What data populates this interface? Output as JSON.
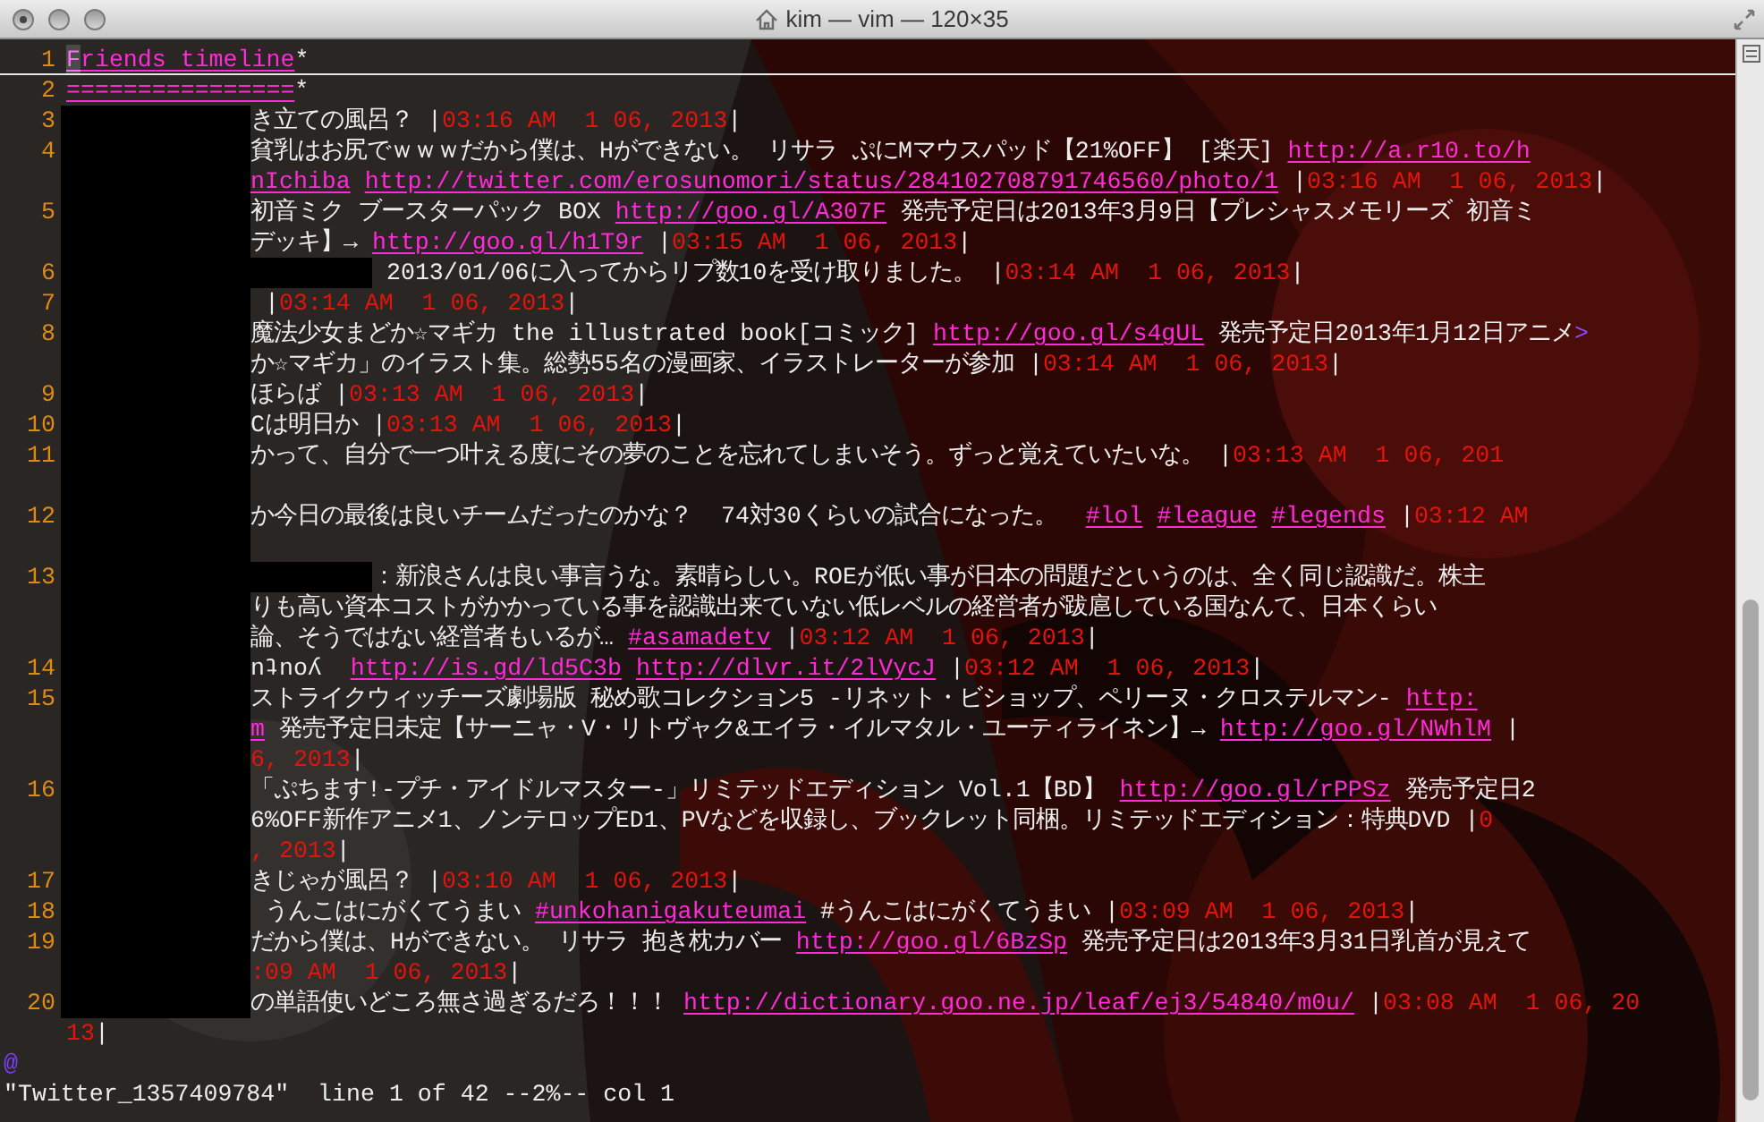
{
  "window": {
    "title": "kim — vim — 120×35"
  },
  "rows": [
    {
      "number": "1",
      "kind": "plain",
      "cursorline": true,
      "segments": [
        {
          "kind": "cursor",
          "text": "F"
        },
        {
          "kind": "title",
          "text": "riends timeline"
        },
        {
          "kind": "text",
          "text": "*"
        }
      ]
    },
    {
      "number": "2",
      "kind": "plain",
      "cursorline": false,
      "segments": [
        {
          "kind": "title",
          "text": "================"
        },
        {
          "kind": "text",
          "text": "*"
        }
      ]
    },
    {
      "number": "3",
      "kind": "redacted",
      "cursorline": false,
      "segments": [
        {
          "kind": "text",
          "text": "き立ての風呂？ |"
        },
        {
          "kind": "time",
          "text": "03:16 AM  1 06, 2013"
        },
        {
          "kind": "text",
          "text": "|"
        }
      ]
    },
    {
      "number": "4",
      "kind": "redacted",
      "cursorline": false,
      "segments": [
        {
          "kind": "text",
          "text": "貧乳はお尻でｗｗｗだから僕は、Hができない。 リサラ ぷにMマウスパッド【21%OFF】 [楽天] "
        },
        {
          "kind": "link",
          "text": "http://a.r10.to/h"
        }
      ]
    },
    {
      "kind": "redacted",
      "cursorline": false,
      "segments": [
        {
          "kind": "link",
          "text": "nIchiba"
        },
        {
          "kind": "link",
          "text": "http://twitter.com/erosunomori/status/284102708791746560/photo/1"
        },
        {
          "kind": "text",
          "text": " |"
        },
        {
          "kind": "time",
          "text": "03:16 AM  1 06, 2013"
        },
        {
          "kind": "text",
          "text": "|"
        }
      ]
    },
    {
      "number": "5",
      "kind": "redacted",
      "cursorline": false,
      "segments": [
        {
          "kind": "text",
          "text": "初音ミク ブースターパック BOX "
        },
        {
          "kind": "link",
          "text": "http://goo.gl/A307F"
        },
        {
          "kind": "text",
          "text": " 発売予定日は2013年3月9日【プレシャスメモリーズ 初音ミ"
        }
      ]
    },
    {
      "kind": "redacted",
      "cursorline": false,
      "segments": [
        {
          "kind": "text",
          "text": "デッキ】→ "
        },
        {
          "kind": "link",
          "text": "http://goo.gl/h1T9r"
        },
        {
          "kind": "text",
          "text": " |"
        },
        {
          "kind": "time",
          "text": "03:15 AM  1 06, 2013"
        },
        {
          "kind": "text",
          "text": "|"
        }
      ]
    },
    {
      "number": "6",
      "kind": "redacted_wide",
      "cursorline": false,
      "segments": [
        {
          "kind": "text",
          "text": " 2013/01/06に入ってからリプ数10を受け取りました。 |"
        },
        {
          "kind": "time",
          "text": "03:14 AM  1 06, 2013"
        },
        {
          "kind": "text",
          "text": "|"
        }
      ]
    },
    {
      "number": "7",
      "kind": "redacted",
      "cursorline": false,
      "segments": [
        {
          "kind": "text",
          "text": " |"
        },
        {
          "kind": "time",
          "text": "03:14 AM  1 06, 2013"
        },
        {
          "kind": "text",
          "text": "|"
        }
      ]
    },
    {
      "number": "8",
      "kind": "redacted",
      "cursorline": false,
      "segments": [
        {
          "kind": "text",
          "text": "魔法少女まどか☆マギカ the illustrated book[コミック] "
        },
        {
          "kind": "link",
          "text": "http://goo.gl/s4gUL"
        },
        {
          "kind": "text",
          "text": " 発売予定日2013年1月12日アニメ"
        },
        {
          "kind": "more",
          "text": ">"
        }
      ]
    },
    {
      "kind": "redacted",
      "cursorline": false,
      "segments": [
        {
          "kind": "text",
          "text": "か☆マギカ」のイラスト集。総勢55名の漫画家、イラストレーターが参加 |"
        },
        {
          "kind": "time",
          "text": "03:14 AM  1 06, 2013"
        },
        {
          "kind": "text",
          "text": "|"
        }
      ]
    },
    {
      "number": "9",
      "kind": "redacted",
      "cursorline": false,
      "segments": [
        {
          "kind": "text",
          "text": "ほらば |"
        },
        {
          "kind": "time",
          "text": "03:13 AM  1 06, 2013"
        },
        {
          "kind": "text",
          "text": "|"
        }
      ]
    },
    {
      "number": "10",
      "kind": "redacted",
      "cursorline": false,
      "segments": [
        {
          "kind": "text",
          "text": "Cは明日か |"
        },
        {
          "kind": "time",
          "text": "03:13 AM  1 06, 2013"
        },
        {
          "kind": "text",
          "text": "|"
        }
      ]
    },
    {
      "number": "11",
      "kind": "redacted",
      "cursorline": false,
      "segments": [
        {
          "kind": "text",
          "text": "かって、自分で一つ叶える度にその夢のことを忘れてしまいそう。ずっと覚えていたいな。 |"
        },
        {
          "kind": "time",
          "text": "03:13 AM  1 06, 201"
        }
      ]
    },
    {
      "kind": "redacted",
      "cursorline": false,
      "segments": []
    },
    {
      "number": "12",
      "kind": "redacted",
      "cursorline": false,
      "segments": [
        {
          "kind": "text",
          "text": "か今日の最後は良いチームだったのかな？  74対30くらいの試合になった。  "
        },
        {
          "kind": "link",
          "text": "#lol"
        },
        {
          "kind": "link",
          "text": "#league"
        },
        {
          "kind": "link",
          "text": "#legends"
        },
        {
          "kind": "text",
          "text": " |"
        },
        {
          "kind": "time",
          "text": "03:12 AM"
        }
      ]
    },
    {
      "kind": "redacted",
      "cursorline": false,
      "segments": []
    },
    {
      "number": "13",
      "kind": "redacted_wide",
      "cursorline": false,
      "segments": [
        {
          "kind": "text",
          "text": "：新浪さんは良い事言うな。素晴らしい。ROEが低い事が日本の問題だというのは、全く同じ認識だ。株主"
        }
      ]
    },
    {
      "kind": "redacted",
      "cursorline": false,
      "segments": [
        {
          "kind": "text",
          "text": "りも高い資本コストがかかっている事を認識出来ていない低レベルの経営者が跋扈している国なんて、日本くらい"
        }
      ]
    },
    {
      "kind": "redacted",
      "cursorline": false,
      "segments": [
        {
          "kind": "text",
          "text": "論、そうではない経営者もいるが… "
        },
        {
          "kind": "link",
          "text": "#asamadetv"
        },
        {
          "kind": "text",
          "text": " |"
        },
        {
          "kind": "time",
          "text": "03:12 AM  1 06, 2013"
        },
        {
          "kind": "text",
          "text": "|"
        }
      ]
    },
    {
      "number": "14",
      "kind": "redacted",
      "cursorline": false,
      "segments": [
        {
          "kind": "text",
          "text": "nʇnoʎ  "
        },
        {
          "kind": "link",
          "text": "http://is.gd/ld5C3b"
        },
        {
          "kind": "link",
          "text": "http://dlvr.it/2lVycJ"
        },
        {
          "kind": "text",
          "text": " |"
        },
        {
          "kind": "time",
          "text": "03:12 AM  1 06, 2013"
        },
        {
          "kind": "text",
          "text": "|"
        }
      ]
    },
    {
      "number": "15",
      "kind": "redacted",
      "cursorline": false,
      "segments": [
        {
          "kind": "text",
          "text": "ストライクウィッチーズ劇場版 秘め歌コレクション5 -リネット・ビショップ、ペリーヌ・クロステルマン- "
        },
        {
          "kind": "link",
          "text": "http:"
        }
      ]
    },
    {
      "kind": "redacted",
      "cursorline": false,
      "segments": [
        {
          "kind": "link",
          "text": "m"
        },
        {
          "kind": "text",
          "text": " 発売予定日未定【サーニャ・V・リトヴャク&エイラ・イルマタル・ユーティライネン】→ "
        },
        {
          "kind": "link",
          "text": "http://goo.gl/NWhlM"
        },
        {
          "kind": "text",
          "text": " |"
        }
      ]
    },
    {
      "kind": "redacted",
      "cursorline": false,
      "segments": [
        {
          "kind": "time",
          "text": "6, 2013"
        },
        {
          "kind": "text",
          "text": "|"
        }
      ]
    },
    {
      "number": "16",
      "kind": "redacted",
      "cursorline": false,
      "segments": [
        {
          "kind": "text",
          "text": "「ぷちます!-プチ・アイドルマスター-」リミテッドエディション Vol.1【BD】 "
        },
        {
          "kind": "link",
          "text": "http://goo.gl/rPPSz"
        },
        {
          "kind": "text",
          "text": " 発売予定日2"
        }
      ]
    },
    {
      "kind": "redacted",
      "cursorline": false,
      "segments": [
        {
          "kind": "text",
          "text": "6%OFF新作アニメ1、ノンテロップED1、PVなどを収録し、ブックレット同梱。リミテッドエディション：特典DVD |"
        },
        {
          "kind": "time",
          "text": "0"
        }
      ]
    },
    {
      "kind": "redacted",
      "cursorline": false,
      "segments": [
        {
          "kind": "time",
          "text": ", 2013"
        },
        {
          "kind": "text",
          "text": "|"
        }
      ]
    },
    {
      "number": "17",
      "kind": "redacted",
      "cursorline": false,
      "segments": [
        {
          "kind": "text",
          "text": "きじゃが風呂？ |"
        },
        {
          "kind": "time",
          "text": "03:10 AM  1 06, 2013"
        },
        {
          "kind": "text",
          "text": "|"
        }
      ]
    },
    {
      "number": "18",
      "kind": "redacted",
      "cursorline": false,
      "segments": [
        {
          "kind": "text",
          "text": " うんこはにがくてうまい "
        },
        {
          "kind": "link",
          "text": "#unkohanigakuteumai"
        },
        {
          "kind": "text",
          "text": " #うんこはにがくてうまい |"
        },
        {
          "kind": "time",
          "text": "03:09 AM  1 06, 2013"
        },
        {
          "kind": "text",
          "text": "|"
        }
      ]
    },
    {
      "number": "19",
      "kind": "redacted",
      "cursorline": false,
      "segments": [
        {
          "kind": "text",
          "text": "だから僕は、Hができない。 リサラ 抱き枕カバー "
        },
        {
          "kind": "link",
          "text": "http://goo.gl/6BzSp"
        },
        {
          "kind": "text",
          "text": " 発売予定日は2013年3月31日乳首が見えて"
        }
      ]
    },
    {
      "kind": "redacted",
      "cursorline": false,
      "segments": [
        {
          "kind": "time",
          "text": ":09 AM  1 06, 2013"
        },
        {
          "kind": "text",
          "text": "|"
        }
      ]
    },
    {
      "number": "20",
      "kind": "redacted",
      "cursorline": false,
      "segments": [
        {
          "kind": "text",
          "text": "の単語使いどころ無さ過ぎるだろ！！！ "
        },
        {
          "kind": "link",
          "text": "http://dictionary.goo.ne.jp/leaf/ej3/54840/m0u/"
        },
        {
          "kind": "text",
          "text": " |"
        },
        {
          "kind": "time",
          "text": "03:08 AM  1 06, 20"
        }
      ]
    },
    {
      "kind": "plain",
      "cursorline": false,
      "segments": [
        {
          "kind": "time",
          "text": "13"
        },
        {
          "kind": "text",
          "text": "|"
        }
      ]
    }
  ],
  "overflow_marker": "@",
  "status_bar": "\"Twitter_1357409784\"  line 1 of 42 --2%-- col 1"
}
